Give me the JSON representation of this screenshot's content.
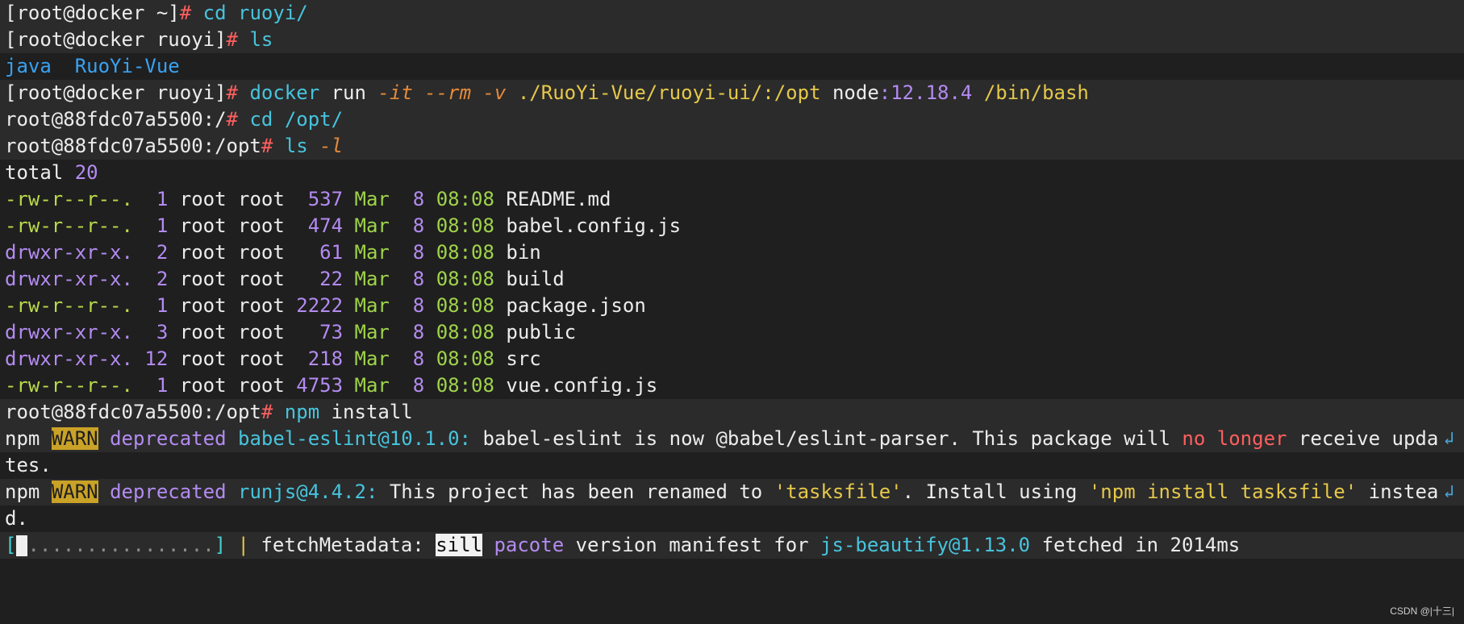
{
  "terminal": {
    "cmd1": {
      "prompt": "[root@docker ~]",
      "hash": "#",
      "command": "cd ruoyi/"
    },
    "cmd2": {
      "prompt": "[root@docker ruoyi]",
      "hash": "#",
      "command": "ls"
    },
    "ls_out": {
      "dir1": "java",
      "dir2": "RuoYi-Vue"
    },
    "cmd3": {
      "prompt": "[root@docker ruoyi]",
      "hash": "#",
      "docker": "docker",
      "run": "run",
      "flag_it": "-it",
      "flag_rm": "--rm",
      "flag_v": "-v",
      "volume": "./RuoYi-Vue/ruoyi-ui/:/opt",
      "image_name": "node",
      "image_tag": ":12.18.4",
      "shell": "/bin/bash"
    },
    "cmd4": {
      "prompt": "root@88fdc07a5500:/",
      "hash": "#",
      "cmd": "cd",
      "arg": "/opt/"
    },
    "cmd5": {
      "prompt": "root@88fdc07a5500:/opt",
      "hash": "#",
      "cmd": "ls",
      "arg": "-l"
    },
    "total": {
      "label": "total",
      "value": "20"
    },
    "files": [
      {
        "perm": "-rw-r--r--.",
        "links": " 1",
        "owner": "root",
        "group": "root",
        "size": " 537",
        "month": "Mar",
        "day": " 8",
        "time": "08:08",
        "name": "README.md"
      },
      {
        "perm": "-rw-r--r--.",
        "links": " 1",
        "owner": "root",
        "group": "root",
        "size": " 474",
        "month": "Mar",
        "day": " 8",
        "time": "08:08",
        "name": "babel.config.js"
      },
      {
        "perm": "drwxr-xr-x.",
        "links": " 2",
        "owner": "root",
        "group": "root",
        "size": "  61",
        "month": "Mar",
        "day": " 8",
        "time": "08:08",
        "name": "bin"
      },
      {
        "perm": "drwxr-xr-x.",
        "links": " 2",
        "owner": "root",
        "group": "root",
        "size": "  22",
        "month": "Mar",
        "day": " 8",
        "time": "08:08",
        "name": "build"
      },
      {
        "perm": "-rw-r--r--.",
        "links": " 1",
        "owner": "root",
        "group": "root",
        "size": "2222",
        "month": "Mar",
        "day": " 8",
        "time": "08:08",
        "name": "package.json"
      },
      {
        "perm": "drwxr-xr-x.",
        "links": " 3",
        "owner": "root",
        "group": "root",
        "size": "  73",
        "month": "Mar",
        "day": " 8",
        "time": "08:08",
        "name": "public"
      },
      {
        "perm": "drwxr-xr-x.",
        "links": "12",
        "owner": "root",
        "group": "root",
        "size": " 218",
        "month": "Mar",
        "day": " 8",
        "time": "08:08",
        "name": "src"
      },
      {
        "perm": "-rw-r--r--.",
        "links": " 1",
        "owner": "root",
        "group": "root",
        "size": "4753",
        "month": "Mar",
        "day": " 8",
        "time": "08:08",
        "name": "vue.config.js"
      }
    ],
    "cmd6": {
      "prompt": "root@88fdc07a5500:/opt",
      "hash": "#",
      "cmd": "npm",
      "arg": "install"
    },
    "warn1": {
      "npm": "npm",
      "level": "WARN",
      "kind": "deprecated",
      "pkg": "babel-eslint@10.1.0:",
      "msg_a": "babel-eslint is now @babel/eslint-parser. This package will",
      "msg_red": "no longer",
      "msg_b": "receive upda",
      "cont": "tes."
    },
    "warn2": {
      "npm": "npm",
      "level": "WARN",
      "kind": "deprecated",
      "pkg": "runjs@4.4.2:",
      "msg_a": "This project has been renamed to",
      "quote1": "'tasksfile'",
      "msg_b": ". Install using",
      "quote2": "'npm install tasksfile'",
      "msg_c": "instea",
      "cont": "d."
    },
    "progress": {
      "dots": "................",
      "sep": "|",
      "stage": "fetchMetadata:",
      "level": "sill",
      "module": "pacote",
      "msg_a": "version manifest for",
      "pkg": "js-beautify@1.13.0",
      "msg_b": "fetched in 2014ms"
    },
    "wrap_icon": "wrap-continuation-icon",
    "wrap_glyph": "↲"
  },
  "watermark": "CSDN @|十三|",
  "colors": {
    "background": "#1f1f1f",
    "highlight": "#2b2b2b",
    "red": "#ff5f5f",
    "blue": "#38a2f2",
    "cyan": "#47c4dd",
    "yellow": "#e6c84a",
    "purple": "#b48bf2",
    "green": "#9fd34a"
  }
}
